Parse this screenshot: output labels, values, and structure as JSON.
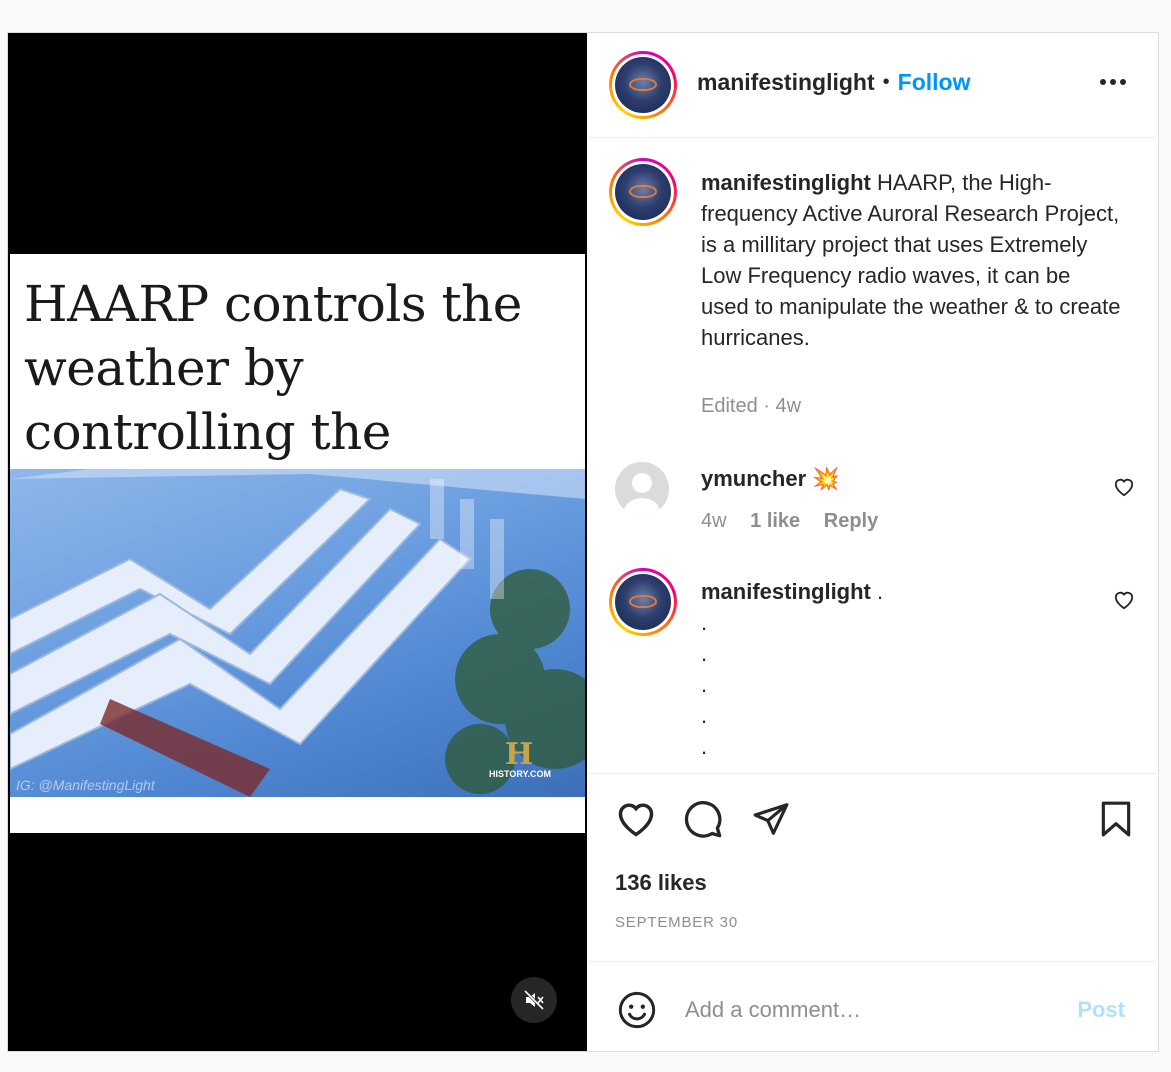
{
  "post": {
    "username": "manifestinglight",
    "follow_label": "Follow",
    "separator": "•",
    "media": {
      "overlay_text": "HAARP controls the weather by controlling the ionosphere",
      "watermark": "IG: @ManifestingLight",
      "logo_letter": "H",
      "logo_text": "HISTORY.COM"
    },
    "caption": {
      "username": "manifestinglight",
      "text": "HAARP, the High-frequency Active Auroral Research Project, is a millitary project that uses Extremely Low Frequency radio waves, it can be used to manipulate the weather & to create hurricanes.",
      "edited_label": "Edited",
      "time": "4w"
    },
    "comments": [
      {
        "username": "ymuncher",
        "text": "💥",
        "time": "4w",
        "likes": "1 like",
        "reply_label": "Reply"
      },
      {
        "username": "manifestinglight",
        "text": ".",
        "dots": [
          ".",
          ".",
          ".",
          ".",
          ".",
          "."
        ]
      }
    ],
    "likes": "136 likes",
    "date": "SEPTEMBER 30",
    "comment_placeholder": "Add a comment…",
    "post_label": "Post"
  },
  "colors": {
    "follow": "#0095f6",
    "post_disabled": "#b2dffc",
    "muted_text": "#8e8e8e"
  }
}
